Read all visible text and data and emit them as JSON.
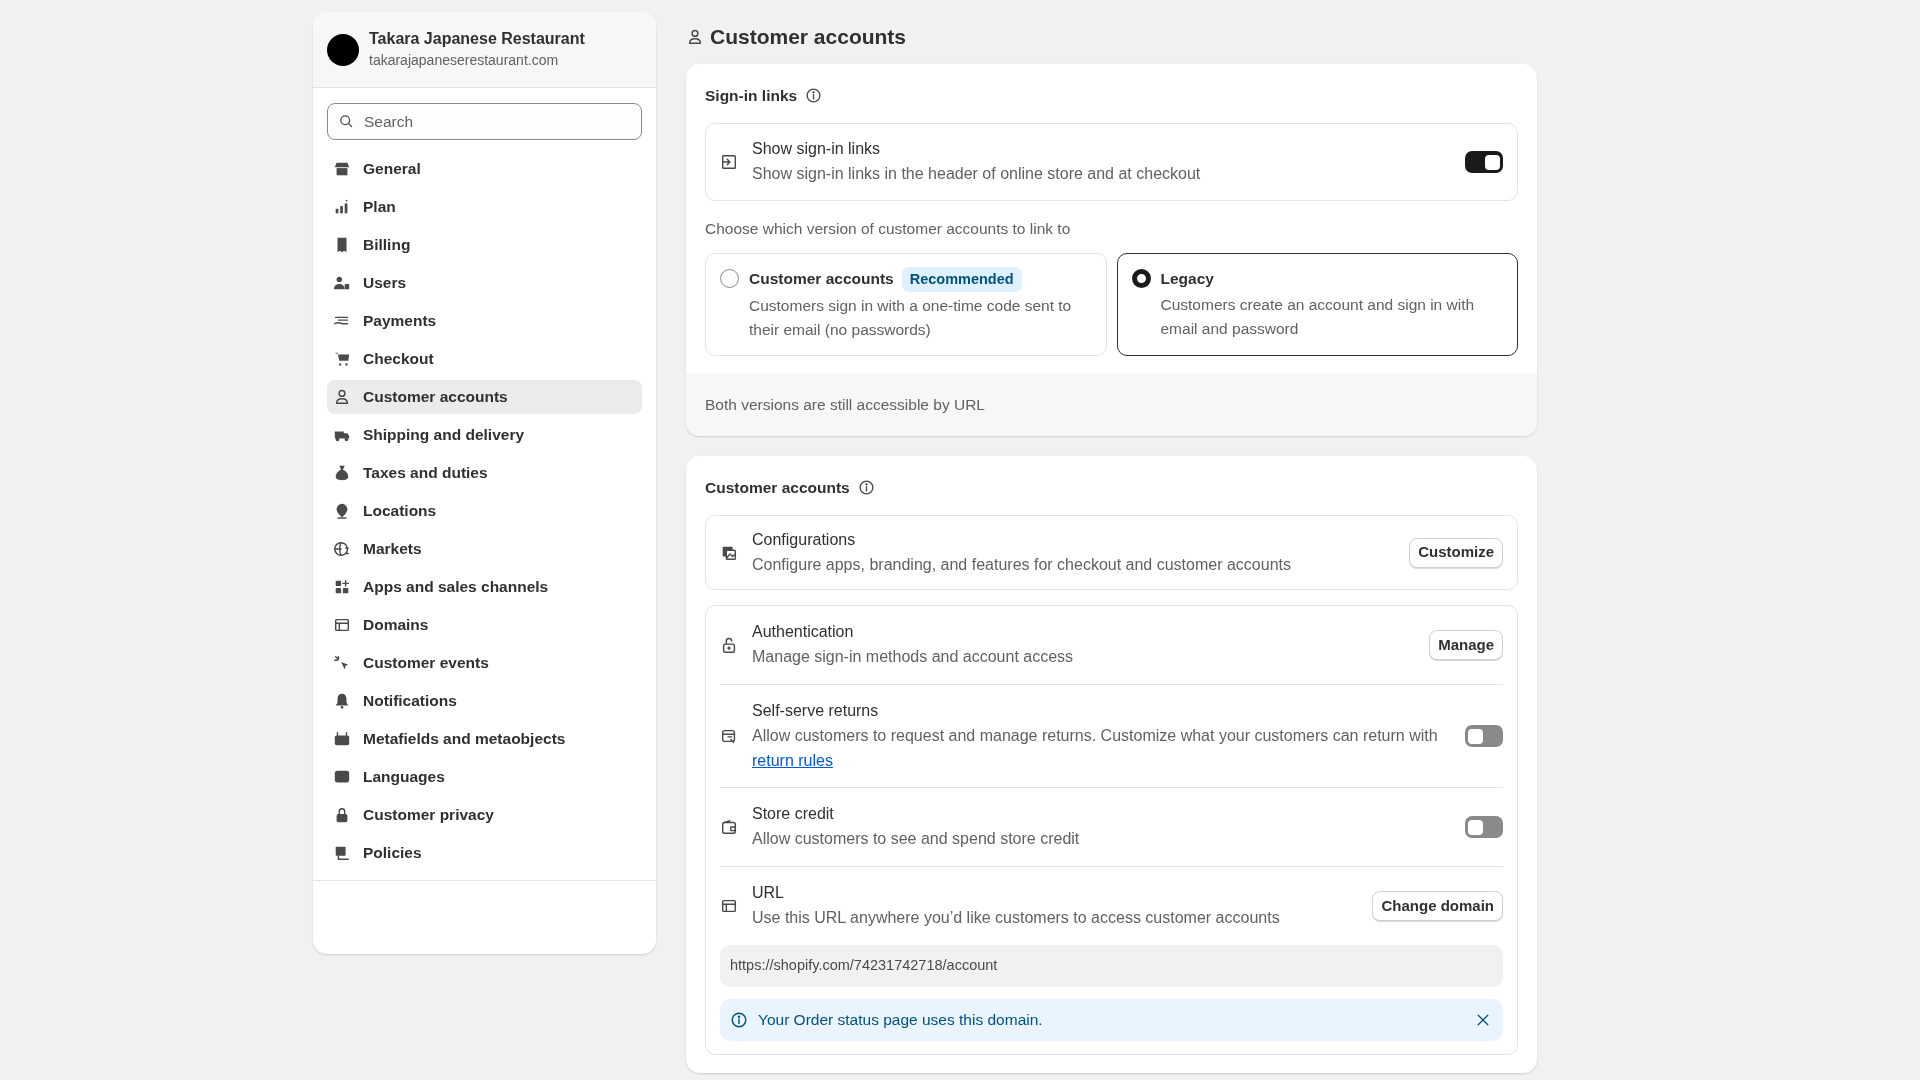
{
  "store": {
    "name": "Takara Japanese Restaurant",
    "domain": "takarajapaneserestaurant.com"
  },
  "search": {
    "placeholder": "Search"
  },
  "nav": [
    {
      "label": "General",
      "selected": false
    },
    {
      "label": "Plan",
      "selected": false
    },
    {
      "label": "Billing",
      "selected": false
    },
    {
      "label": "Users",
      "selected": false
    },
    {
      "label": "Payments",
      "selected": false
    },
    {
      "label": "Checkout",
      "selected": false
    },
    {
      "label": "Customer accounts",
      "selected": true
    },
    {
      "label": "Shipping and delivery",
      "selected": false
    },
    {
      "label": "Taxes and duties",
      "selected": false
    },
    {
      "label": "Locations",
      "selected": false
    },
    {
      "label": "Markets",
      "selected": false
    },
    {
      "label": "Apps and sales channels",
      "selected": false
    },
    {
      "label": "Domains",
      "selected": false
    },
    {
      "label": "Customer events",
      "selected": false
    },
    {
      "label": "Notifications",
      "selected": false
    },
    {
      "label": "Metafields and metaobjects",
      "selected": false
    },
    {
      "label": "Languages",
      "selected": false
    },
    {
      "label": "Customer privacy",
      "selected": false
    },
    {
      "label": "Policies",
      "selected": false
    }
  ],
  "page_title": "Customer accounts",
  "sign_in": {
    "heading": "Sign-in links",
    "show_links": {
      "title": "Show sign-in links",
      "description": "Show sign-in links in the header of online store and at checkout",
      "on": true
    },
    "prompt": "Choose which version of customer accounts to link to",
    "options": [
      {
        "title": "Customer accounts",
        "badge": "Recommended",
        "description": "Customers sign in with a one-time code sent to their email (no passwords)",
        "selected": false
      },
      {
        "title": "Legacy",
        "description": "Customers create an account and sign in with email and password",
        "selected": true
      }
    ],
    "footer": "Both versions are still accessible by URL"
  },
  "accounts": {
    "heading": "Customer accounts",
    "config": {
      "title": "Configurations",
      "description": "Configure apps, branding, and features for checkout and customer accounts",
      "button": "Customize"
    },
    "rows": [
      {
        "kind": "button",
        "title": "Authentication",
        "description": "Manage sign-in methods and account access",
        "button": "Manage"
      },
      {
        "kind": "toggle",
        "title": "Self-serve returns",
        "description": "Allow customers to request and manage returns. Customize what your customers can return with",
        "link": "return rules",
        "on": false
      },
      {
        "kind": "toggle",
        "title": "Store credit",
        "description": "Allow customers to see and spend store credit",
        "on": false
      },
      {
        "kind": "button",
        "title": "URL",
        "description": "Use this URL anywhere you’d like customers to access customer accounts",
        "button": "Change domain"
      }
    ],
    "url": "https://shopify.com/74231742718/account",
    "banner": "Your Order status page uses this domain."
  }
}
